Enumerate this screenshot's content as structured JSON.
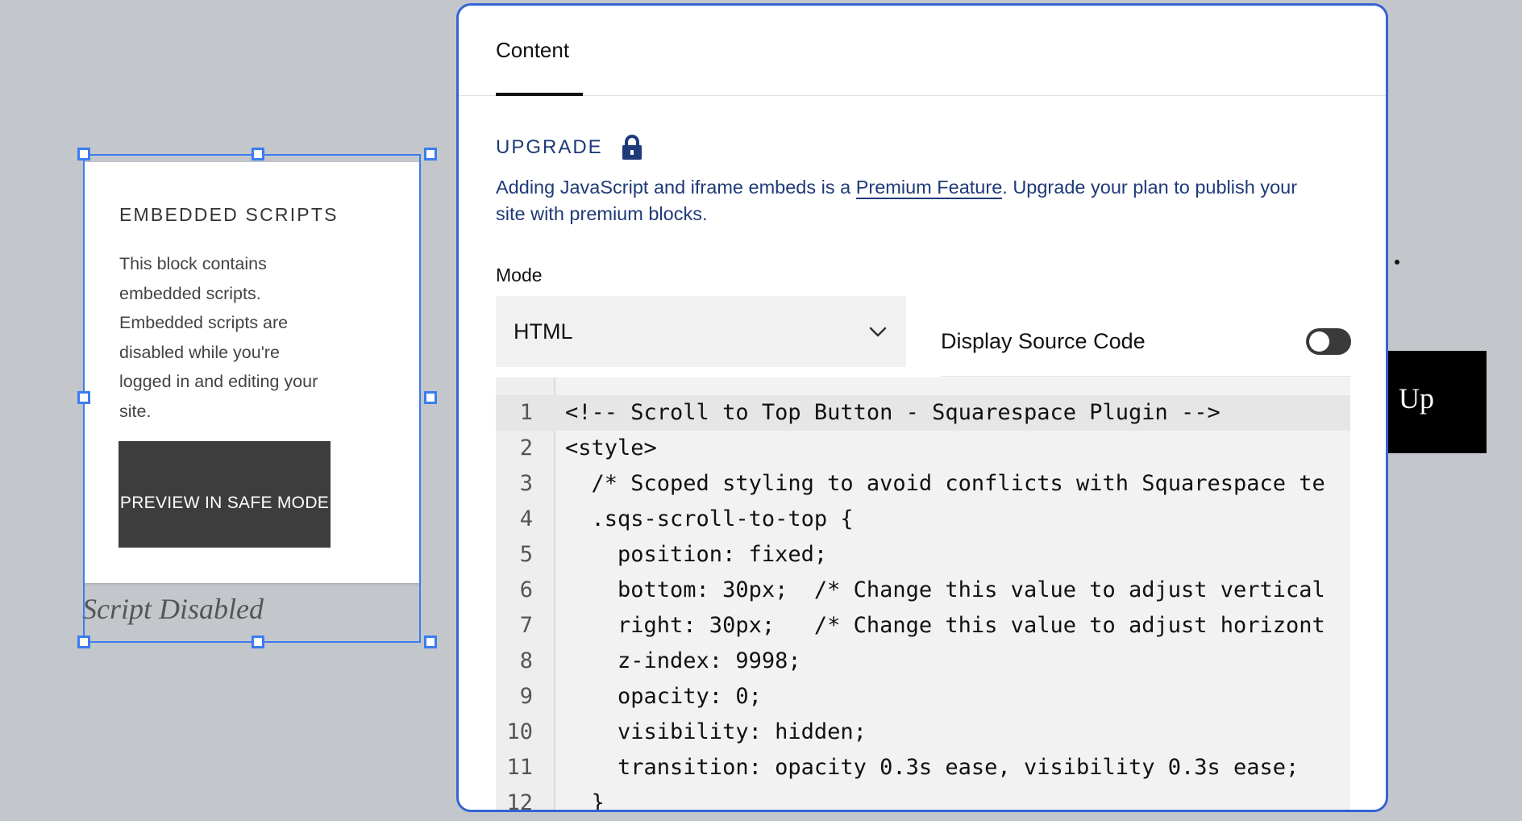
{
  "background": {
    "button_text": "Up"
  },
  "embed_block": {
    "title": "EMBEDDED SCRIPTS",
    "body": "This block contains embedded scripts. Embedded scripts are disabled while you're logged in and editing your site.",
    "button_label": "PREVIEW IN SAFE MODE",
    "caption": "Script Disabled"
  },
  "panel": {
    "tab_label": "Content",
    "upgrade": {
      "label": "UPGRADE",
      "text_before": "Adding JavaScript and iframe embeds is a ",
      "link": "Premium Feature",
      "text_after": ". Upgrade your plan to publish your site with premium blocks."
    },
    "mode": {
      "label": "Mode",
      "value": "HTML"
    },
    "display_source": {
      "label": "Display Source Code",
      "enabled": false
    },
    "code": {
      "active_line": 1,
      "lines": [
        "<!-- Scroll to Top Button - Squarespace Plugin -->",
        "<style>",
        "  /* Scoped styling to avoid conflicts with Squarespace te",
        "  .sqs-scroll-to-top {",
        "    position: fixed;",
        "    bottom: 30px;  /* Change this value to adjust vertical",
        "    right: 30px;   /* Change this value to adjust horizont",
        "    z-index: 9998;",
        "    opacity: 0;",
        "    visibility: hidden;",
        "    transition: opacity 0.3s ease, visibility 0.3s ease;",
        "  }"
      ]
    }
  },
  "colors": {
    "accent_blue": "#3663d4",
    "selection_blue": "#3b7cf0",
    "upgrade_navy": "#1f3a78",
    "canvas_gray": "#c3c7cc"
  }
}
